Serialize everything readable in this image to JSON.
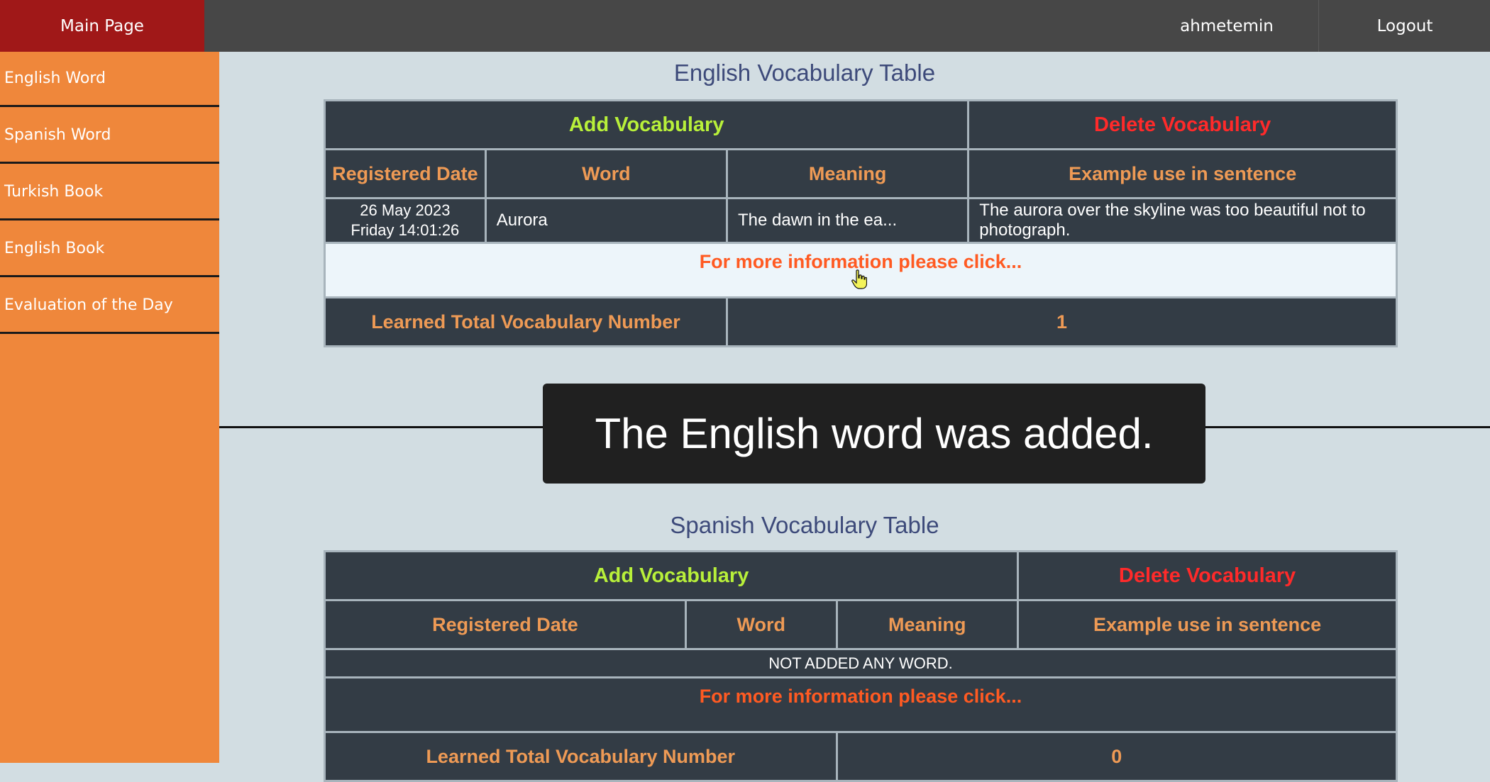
{
  "header": {
    "main_page": "Main Page",
    "username": "ahmetemin",
    "logout": "Logout"
  },
  "sidebar": {
    "items": [
      {
        "label": "English Word"
      },
      {
        "label": "Spanish Word"
      },
      {
        "label": "Turkish Book"
      },
      {
        "label": "English Book"
      },
      {
        "label": "Evaluation of the Day"
      }
    ]
  },
  "english": {
    "title": "English Vocabulary Table",
    "add": "Add Vocabulary",
    "delete": "Delete Vocabulary",
    "headers": [
      "Registered Date",
      "Word",
      "Meaning",
      "Example use in sentence"
    ],
    "rows": [
      {
        "date_line1": "26 May 2023",
        "date_line2": "Friday 14:01:26",
        "word": "Aurora",
        "meaning": "The dawn in the ea...",
        "example": "The aurora over the skyline was too beautiful not to photograph."
      }
    ],
    "more": "For more information please click...",
    "total_label": "Learned Total Vocabulary Number",
    "total_value": "1"
  },
  "toast": {
    "message": "The English word was added."
  },
  "spanish": {
    "title": "Spanish Vocabulary Table",
    "add": "Add Vocabulary",
    "delete": "Delete Vocabulary",
    "headers": [
      "Registered Date",
      "Word",
      "Meaning",
      "Example use in sentence"
    ],
    "empty": "NOT ADDED ANY WORD.",
    "more": "For more information please click...",
    "total_label": "Learned Total Vocabulary Number",
    "total_value": "0"
  },
  "colors": {
    "sidebar": "#ef873b",
    "topbar": "#474747",
    "main_page_bg": "#a01818",
    "table_bg": "#333c45",
    "add_text": "#b8f03a",
    "delete_text": "#ff2a2a",
    "header_text": "#ee9a55",
    "more_text": "#ff5a22"
  }
}
